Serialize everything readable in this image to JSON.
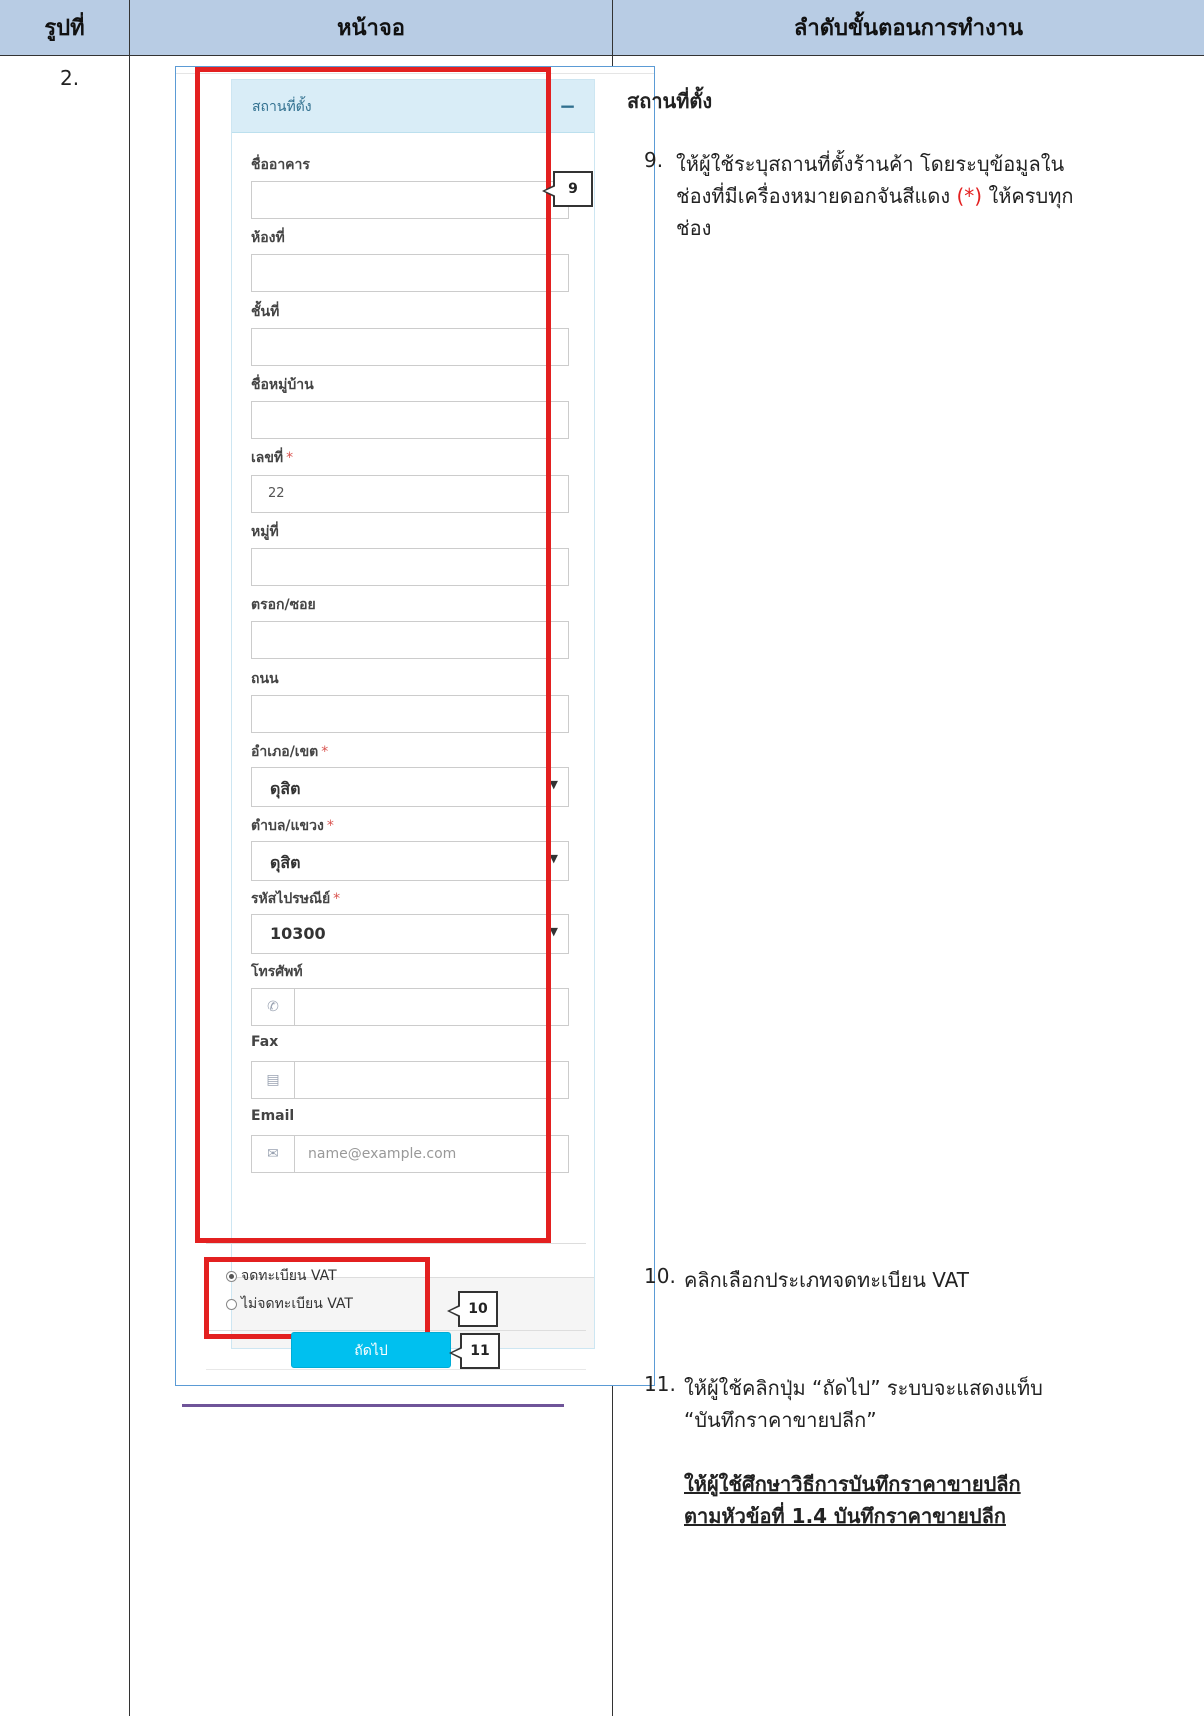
{
  "headers": {
    "col1": "รูปที่",
    "col2": "หน้าจอ",
    "col3": "ลำดับขั้นตอนการทำงาน"
  },
  "figure_number": "2.",
  "screen": {
    "panel_title": "สถานที่ตั้ง",
    "fields": {
      "building": {
        "label": "ชื่ออาคาร",
        "value": ""
      },
      "room": {
        "label": "ห้องที่",
        "value": ""
      },
      "floor": {
        "label": "ชั้นที่",
        "value": ""
      },
      "village": {
        "label": "ชื่อหมู่บ้าน",
        "value": ""
      },
      "house_no": {
        "label": "เลขที่",
        "value": "22",
        "required": "*"
      },
      "moo": {
        "label": "หมู่ที่",
        "value": ""
      },
      "soi": {
        "label": "ตรอก/ซอย",
        "value": ""
      },
      "road": {
        "label": "ถนน",
        "value": ""
      },
      "district": {
        "label": "อำเภอ/เขต",
        "value": "ดุสิต",
        "required": "*"
      },
      "subdistrict": {
        "label": "ตำบล/แขวง",
        "value": "ดุสิต",
        "required": "*"
      },
      "postcode": {
        "label": "รหัสไปรษณีย์",
        "value": "10300",
        "required": "*"
      },
      "phone": {
        "label": "โทรศัพท์",
        "value": "",
        "icon": "phone-icon"
      },
      "fax": {
        "label": "Fax",
        "value": "",
        "icon": "fax-icon"
      },
      "email": {
        "label": "Email",
        "placeholder": "name@example.com",
        "icon": "envelope-icon"
      }
    },
    "vat_options": [
      {
        "label": "จดทะเบียน VAT",
        "selected": true
      },
      {
        "label": "ไม่จดทะเบียน VAT",
        "selected": false
      }
    ],
    "next_button": "ถัดไป",
    "callouts": {
      "c9": "9",
      "c10": "10",
      "c11": "11"
    }
  },
  "steps": {
    "section_title": "สถานที่ตั้ง",
    "step9": {
      "number": "9.",
      "line1": "ให้ผู้ใช้ระบุสถานที่ตั้งร้านค้า โดยระบุข้อมูลใน",
      "line2_pre": "ช่องที่มีเครื่องหมายดอกจันสีแดง ",
      "line2_red": "(*)",
      "line2_post": " ให้ครบทุก",
      "line3": "ช่อง"
    },
    "step10": {
      "number": "10.",
      "text": "คลิกเลือกประเภทจดทะเบียน VAT"
    },
    "step11": {
      "number": "11.",
      "line1": "ให้ผู้ใช้คลิกปุ่ม “ถัดไป” ระบบจะแสดงแท็บ",
      "line2": "“บันทึกราคาขายปลีก”"
    },
    "note": {
      "line1": "ให้ผู้ใช้ศึกษาวิธีการบันทึกราคาขายปลีก",
      "line2": "ตามหัวข้อที่ 1.4 บันทึกราคาขายปลีก"
    }
  },
  "colors": {
    "header_bg": "#b8cce4",
    "highlight": "#e32020",
    "button": "#00c0ef",
    "panel_head": "#d9edf7"
  }
}
